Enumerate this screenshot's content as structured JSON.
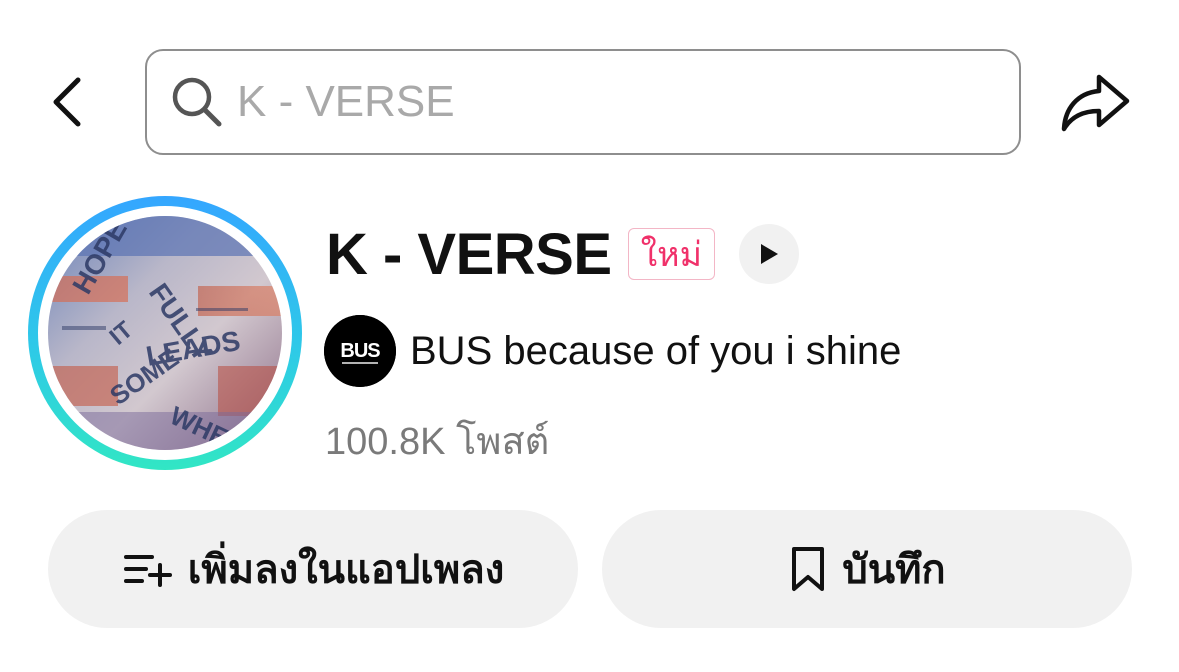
{
  "search": {
    "placeholder": "K - VERSE"
  },
  "header": {
    "back_icon": "chevron-left-icon",
    "share_icon": "share-arrow-icon"
  },
  "sound": {
    "title": "K - VERSE",
    "badge": "ใหม่",
    "artist": "BUS because of you i shine",
    "artist_logo_text": "BUS",
    "post_count": "100.8K โพสต์"
  },
  "actions": {
    "add_to_music_app": "เพิ่มลงในแอปเพลง",
    "save": "บันทึก"
  },
  "colors": {
    "badge_text": "#f0316a",
    "ring_top": "#34a6ff",
    "ring_bottom": "#31e6c4",
    "button_bg": "#f1f1f1"
  }
}
